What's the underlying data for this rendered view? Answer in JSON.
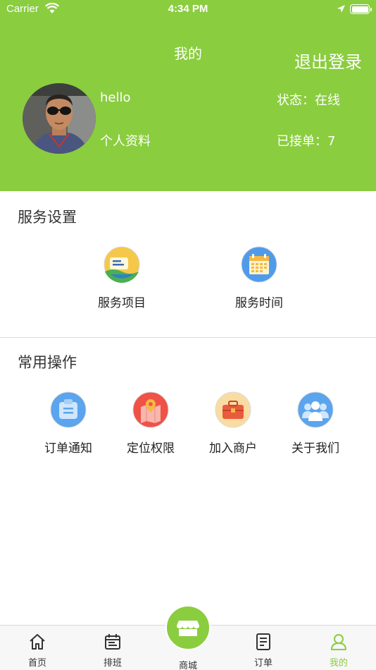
{
  "status_bar": {
    "carrier": "Carrier",
    "time": "4:34 PM"
  },
  "header": {
    "title": "我的",
    "logout_label": "退出登录",
    "username": "hello",
    "profile_label": "个人资料",
    "status_text": "状态：在线",
    "orders_text": "已接单：7",
    "background_color": "#8acd3f"
  },
  "service_settings": {
    "title": "服务设置",
    "items": [
      {
        "label": "服务项目",
        "icon": "service-items-icon"
      },
      {
        "label": "服务时间",
        "icon": "calendar-icon"
      }
    ]
  },
  "common_ops": {
    "title": "常用操作",
    "items": [
      {
        "label": "订单通知",
        "icon": "order-notice-icon"
      },
      {
        "label": "定位权限",
        "icon": "map-pin-icon"
      },
      {
        "label": "加入商户",
        "icon": "toolbox-icon"
      },
      {
        "label": "关于我们",
        "icon": "people-icon"
      }
    ]
  },
  "tabbar": {
    "tabs": [
      {
        "label": "首页",
        "icon": "home-icon"
      },
      {
        "label": "排班",
        "icon": "schedule-icon"
      },
      {
        "label": "商城",
        "icon": "store-icon"
      },
      {
        "label": "订单",
        "icon": "order-list-icon"
      },
      {
        "label": "我的",
        "icon": "user-icon"
      }
    ],
    "active_index": 4,
    "active_color": "#8acd3f"
  }
}
